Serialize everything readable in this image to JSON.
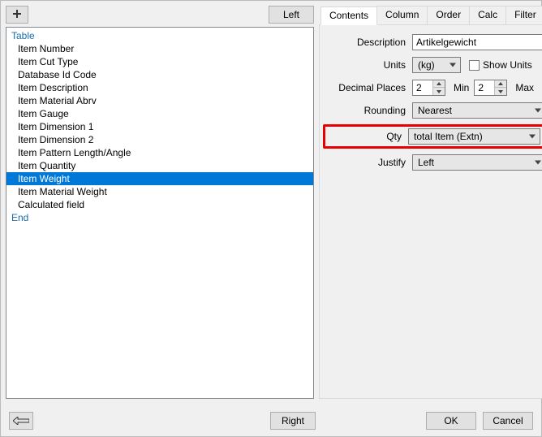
{
  "left": {
    "btn_left": "Left",
    "btn_right": "Right",
    "head_table": "Table",
    "head_end": "End",
    "items": [
      "Item Number",
      "Item Cut Type",
      "Database Id Code",
      "Item Description",
      "Item Material Abrv",
      "Item Gauge",
      "Item Dimension 1",
      "Item Dimension 2",
      "Item Pattern Length/Angle",
      "Item Quantity",
      "Item Weight",
      "Item Material Weight",
      "Calculated field"
    ],
    "selected_index": 10
  },
  "tabs": [
    "Contents",
    "Column",
    "Order",
    "Calc",
    "Filter"
  ],
  "active_tab": 0,
  "form": {
    "description_label": "Description",
    "description": "Artikelgewicht",
    "units_label": "Units",
    "units": "(kg)",
    "show_units_label": "Show Units",
    "show_units_checked": false,
    "decimal_label": "Decimal Places",
    "decimal": "2",
    "min_label": "Min",
    "min": "2",
    "max_label": "Max",
    "rounding_label": "Rounding",
    "rounding": "Nearest",
    "qty_label": "Qty",
    "qty": "total Item (Extn)",
    "justify_label": "Justify",
    "justify": "Left"
  },
  "buttons": {
    "ok": "OK",
    "cancel": "Cancel"
  }
}
